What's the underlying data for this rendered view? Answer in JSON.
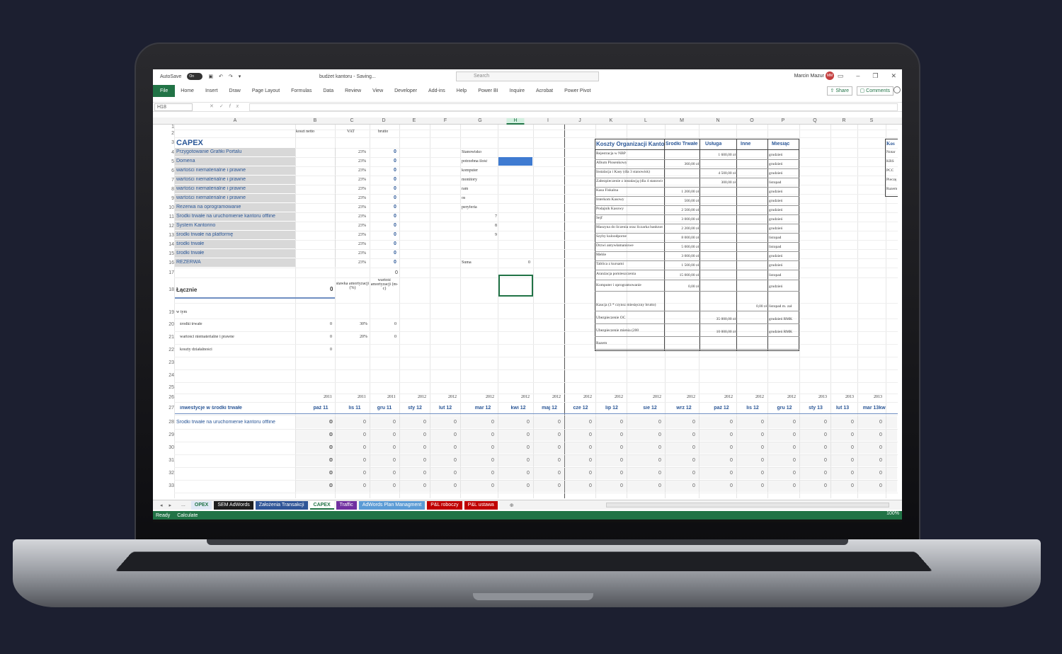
{
  "window": {
    "autosave_label": "AutoSave",
    "autosave_state": "On",
    "filename": "budżet kantoru",
    "save_status": "Saving...",
    "search_placeholder": "Search",
    "user_name": "Marcin Mazur",
    "user_initials": "MM"
  },
  "ribbon": {
    "tabs": [
      "File",
      "Home",
      "Insert",
      "Draw",
      "Page Layout",
      "Formulas",
      "Data",
      "Review",
      "View",
      "Developer",
      "Add-ins",
      "Help",
      "Power BI",
      "Inquire",
      "Acrobat",
      "Power Pivot"
    ],
    "share": "Share",
    "comments": "Comments"
  },
  "formula_bar": {
    "name_box": "H18",
    "fx": "fx",
    "value": ""
  },
  "columns": [
    "A",
    "B",
    "C",
    "D",
    "E",
    "F",
    "G",
    "H",
    "I",
    "J",
    "K",
    "L",
    "M",
    "N",
    "O",
    "P",
    "Q",
    "R",
    "S"
  ],
  "rows": [
    "1",
    "2",
    "3",
    "4",
    "5",
    "6",
    "7",
    "8",
    "9",
    "10",
    "11",
    "12",
    "13",
    "14",
    "15",
    "16",
    "17",
    "18",
    "19",
    "20",
    "21",
    "22",
    "23",
    "24",
    "25",
    "26",
    "27",
    "28",
    "29",
    "30",
    "31",
    "32",
    "33"
  ],
  "capex": {
    "headers": {
      "net": "koszt netto",
      "vat": "VAT",
      "gross": "brutto"
    },
    "title": "CAPEX",
    "items": [
      {
        "name": "Przygotowanie Grafiki Portalu",
        "vat": "23%",
        "gross": "0"
      },
      {
        "name": "Domena",
        "vat": "23%",
        "gross": "0"
      },
      {
        "name": "wartości niematerialne i prawne",
        "vat": "23%",
        "gross": "0"
      },
      {
        "name": "wartości niematerialne i prawne",
        "vat": "23%",
        "gross": "0"
      },
      {
        "name": "wartości niematerialne i prawne",
        "vat": "23%",
        "gross": "0"
      },
      {
        "name": "wartości niematerialne i prawne",
        "vat": "23%",
        "gross": "0"
      },
      {
        "name": "Rezerwa na oprogramowanie",
        "vat": "23%",
        "gross": "0"
      },
      {
        "name": "Środki trwałe na uruchomienie kantoru offline",
        "vat": "23%",
        "gross": "0"
      },
      {
        "name": "System Kantorino",
        "vat": "23%",
        "gross": "0"
      },
      {
        "name": "środki trwałe na platformę",
        "vat": "23%",
        "gross": "0"
      },
      {
        "name": "środki trwałe",
        "vat": "23%",
        "gross": "0"
      },
      {
        "name": "środki trwałe",
        "vat": "23%",
        "gross": "0"
      },
      {
        "name": "REZERWA",
        "vat": "23%",
        "gross": "0"
      }
    ],
    "row17_d": "0",
    "total_label": "Łącznie",
    "total_value": "0",
    "rate_header": "stawka amortyzacji (%)",
    "amort_header": "wartość amortyzacji (m-c)",
    "in_that": "w tym",
    "breakdown": [
      {
        "name": "środki trwałe",
        "value": "0",
        "rate": "30%",
        "amort": "0"
      },
      {
        "name": "wartości niematerialne i prawne",
        "value": "0",
        "rate": "20%",
        "amort": "0"
      },
      {
        "name": "koszty działalności",
        "value": "0",
        "rate": "",
        "amort": ""
      }
    ]
  },
  "equipment": {
    "items": [
      "Stanowisko",
      "potrzebna ilość",
      "komputer",
      "monitory",
      "ram",
      "os",
      "peryferia"
    ],
    "numbers": [
      "7",
      "8",
      "9"
    ],
    "sum_label": "Suma",
    "sum_value": "0"
  },
  "org_costs": {
    "title": "Koszty Organizacji Kanto",
    "cols": [
      "Środki Trwałe",
      "Usługa",
      "Inne",
      "Miesiąc"
    ],
    "rows": [
      {
        "name": "Rejestracja w NBP",
        "st": "",
        "usl": "1 600,00 zł",
        "inne": "",
        "month": "grudzień"
      },
      {
        "name": "Album Piosenkowy",
        "st": "360,00 zł",
        "usl": "",
        "inne": "",
        "month": "grudzień"
      },
      {
        "name": "Instalacja i Kasy (dla 3 stanowisk)",
        "st": "",
        "usl": "4 500,00 zł",
        "inne": "",
        "month": "grudzień"
      },
      {
        "name": "Zabezpieczenie z instalacją (dla 4 stanowisk)",
        "st": "",
        "usl": "300,00 zł",
        "inne": "",
        "month": "listopad"
      },
      {
        "name": "Kasa Fiskalna",
        "st": "1 200,00 zł",
        "usl": "",
        "inne": "",
        "month": "grudzień"
      },
      {
        "name": "Interkom Kasowy",
        "st": "500,00 zł",
        "usl": "",
        "inne": "",
        "month": "grudzień"
      },
      {
        "name": "Podajnik Kasowy",
        "st": "2 500,00 zł",
        "usl": "",
        "inne": "",
        "month": "grudzień"
      },
      {
        "name": "Sejf",
        "st": "3 000,00 zł",
        "usl": "",
        "inne": "",
        "month": "grudzień"
      },
      {
        "name": "Maszyna do liczenia oraz liczarka banknotów",
        "st": "2 200,00 zł",
        "usl": "",
        "inne": "",
        "month": "grudzień"
      },
      {
        "name": "Szyby kuloodporne",
        "st": "8 000,00 zł",
        "usl": "",
        "inne": "",
        "month": "listopad"
      },
      {
        "name": "Drzwi antywłamaniowe",
        "st": "5 000,00 zł",
        "usl": "",
        "inne": "",
        "month": "listopad"
      },
      {
        "name": "Meble",
        "st": "3 000,00 zł",
        "usl": "",
        "inne": "",
        "month": "grudzień"
      },
      {
        "name": "Tablica z kursami",
        "st": "1 500,00 zł",
        "usl": "",
        "inne": "",
        "month": "grudzień"
      },
      {
        "name": "Aranżacja pomieszczenia",
        "st": "15 000,00 zł",
        "usl": "",
        "inne": "",
        "month": "listopad"
      },
      {
        "name": "Komputer i oprogramowanie",
        "st": "0,00 zł",
        "usl": "",
        "inne": "",
        "month": "grudzień"
      },
      {
        "name": "Kaucja (3 * czynsz miesięczny brutto)",
        "st": "",
        "usl": "",
        "inne": "0,00 zł",
        "month": "listopad m. zał"
      },
      {
        "name": "Ubezpieczenie OC",
        "st": "",
        "usl": "35 000,00 zł",
        "inne": "",
        "month": "grudzień RMK"
      },
      {
        "name": "Ubezpieczenie mienia (200",
        "st": "",
        "usl": "10 000,00 zł",
        "inne": "",
        "month": "grudzień RMK"
      },
      {
        "name": "Razem",
        "st": "",
        "usl": "",
        "inne": "",
        "month": ""
      }
    ],
    "side": [
      "Kos",
      "Notar",
      "KRS",
      "PCC",
      "Pieczę",
      "Razem"
    ]
  },
  "timeline": {
    "years": [
      "2011",
      "2011",
      "2011",
      "2012",
      "2012",
      "2012",
      "2012",
      "2012",
      "2012",
      "2012",
      "2012",
      "2012",
      "2012",
      "2012",
      "2012",
      "2013",
      "2013",
      "2013"
    ],
    "label": "inwestycje w środki trwałe",
    "months": [
      "paź 11",
      "lis 11",
      "gru 11",
      "sty 12",
      "lut 12",
      "mar 12",
      "kwi 12",
      "maj 12",
      "cze 12",
      "lip 12",
      "sie 12",
      "wrz 12",
      "paź 12",
      "lis 12",
      "gru 12",
      "sty 13",
      "lut 13",
      "mar 13",
      "kw"
    ],
    "row28_label": "Środki trwałe na uruchomienie kantoru offline",
    "zero": "0"
  },
  "sheet_tabs": [
    {
      "label": "...",
      "color": "none"
    },
    {
      "label": "OPEX",
      "color": "#dfe8f5"
    },
    {
      "label": "SEM AdWords",
      "color": "#1e1e1e"
    },
    {
      "label": "Założenia Transakcji",
      "color": "#2f5597"
    },
    {
      "label": "CAPEX",
      "color": "#ffffff"
    },
    {
      "label": "Traffic",
      "color": "#7030a0"
    },
    {
      "label": "AdWords Plan Managment",
      "color": "#5b9bd5"
    },
    {
      "label": "P&L roboczy",
      "color": "#c00000"
    },
    {
      "label": "P&L ustawa",
      "color": "#c00000"
    }
  ],
  "status": {
    "ready": "Ready",
    "calculate": "Calculate",
    "zoom": "100%"
  },
  "accent": "#217346"
}
